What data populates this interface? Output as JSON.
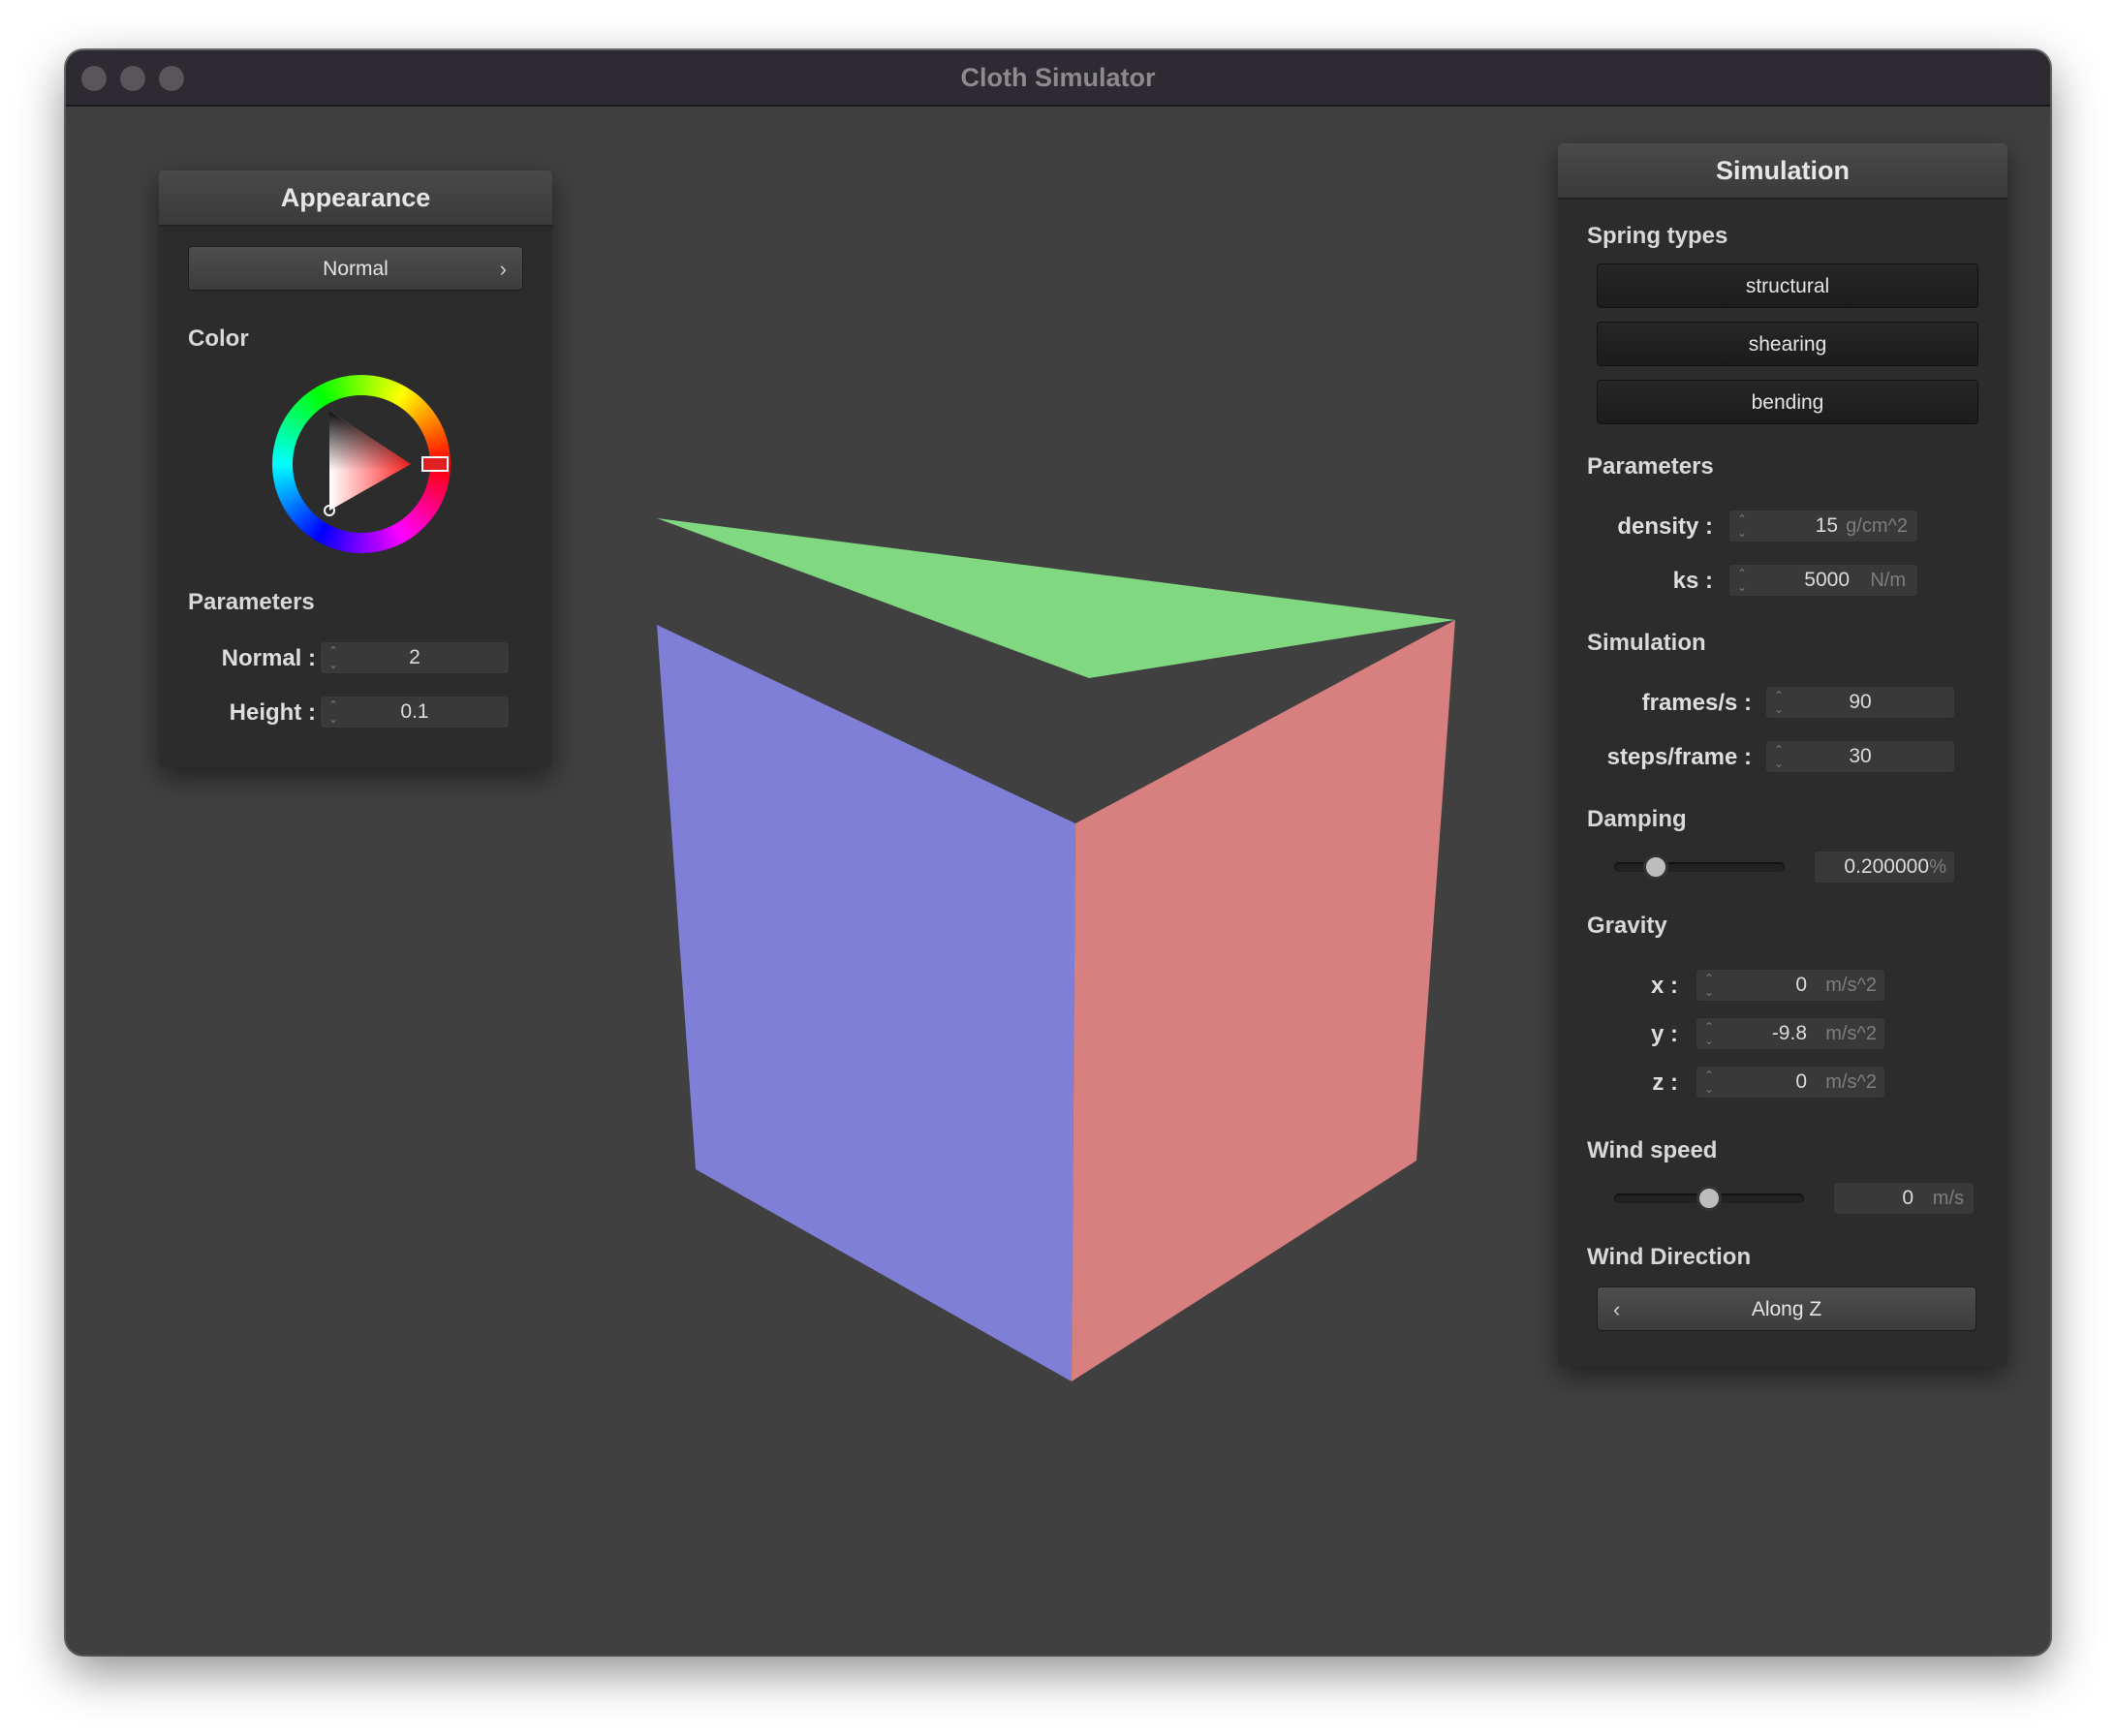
{
  "window": {
    "title": "Cloth Simulator"
  },
  "appearance": {
    "title": "Appearance",
    "shader_select": "Normal",
    "color_label": "Color",
    "color_value": "#e02020",
    "parameters_label": "Parameters",
    "normal_label": "Normal :",
    "normal_value": "2",
    "height_label": "Height :",
    "height_value": "0.1"
  },
  "simulation": {
    "title": "Simulation",
    "spring_types_label": "Spring types",
    "spring_buttons": [
      "structural",
      "shearing",
      "bending"
    ],
    "parameters_label": "Parameters",
    "density_label": "density :",
    "density_value": "15",
    "density_unit": "g/cm^2",
    "ks_label": "ks :",
    "ks_value": "5000",
    "ks_unit": "N/m",
    "simulation_label": "Simulation",
    "fps_label": "frames/s :",
    "fps_value": "90",
    "steps_label": "steps/frame :",
    "steps_value": "30",
    "damping_label": "Damping",
    "damping_value": "0.200000",
    "damping_unit": "%",
    "damping_slider_fraction": 0.2,
    "gravity_label": "Gravity",
    "gx_label": "x :",
    "gx_value": "0",
    "gy_label": "y :",
    "gy_value": "-9.8",
    "gz_label": "z :",
    "gz_value": "0",
    "gravity_unit": "m/s^2",
    "wind_speed_label": "Wind speed",
    "wind_speed_value": "0",
    "wind_speed_unit": "m/s",
    "wind_slider_fraction": 0.5,
    "wind_direction_label": "Wind Direction",
    "wind_direction_value": "Along Z"
  },
  "scene": {
    "top_face_color": "#80d880",
    "left_face_color": "#7f7fd8",
    "right_face_color": "#d87f7f"
  }
}
